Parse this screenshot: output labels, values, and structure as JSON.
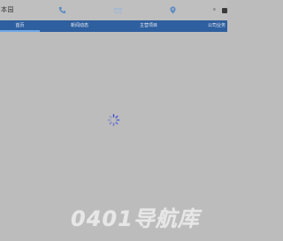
{
  "header": {
    "brand": "本园",
    "extra_glyph": "≡"
  },
  "nav": {
    "items": [
      {
        "label": "首页"
      },
      {
        "label": "新闻动态"
      },
      {
        "label": "主营项目"
      },
      {
        "label": "公司业务"
      }
    ],
    "active_index": 0
  },
  "loading": {
    "icon": "loading-spinner-icon",
    "color": "#3b4bd8"
  },
  "watermark": {
    "text": "0401导航库"
  },
  "colors": {
    "nav_bar": "#2e5f9f",
    "overlay": "#bcbcbc",
    "icon": "#5b8bc6"
  }
}
